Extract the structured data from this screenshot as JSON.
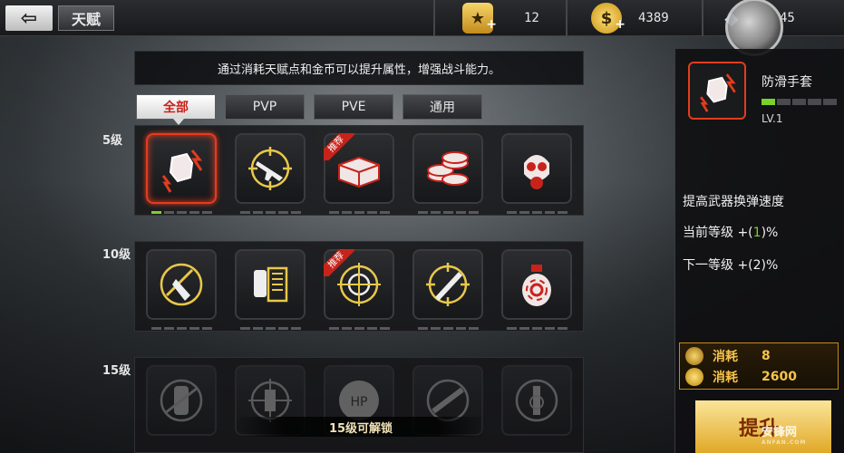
{
  "header": {
    "title": "天赋",
    "back_icon": "back-arrow-icon"
  },
  "resources": [
    {
      "icon": "rank-badge-icon",
      "value": "12"
    },
    {
      "icon": "gold-coin-icon",
      "value": "4389"
    },
    {
      "icon": "diamond-icon",
      "value": "45"
    }
  ],
  "notice": "通过消耗天赋点和金币可以提升属性，增强战斗能力。",
  "tabs": [
    {
      "label": "全部",
      "active": true
    },
    {
      "label": "PVP",
      "active": false
    },
    {
      "label": "PVE",
      "active": false
    },
    {
      "label": "通用",
      "active": false
    }
  ],
  "tiers": [
    {
      "label": "5级",
      "talents": [
        {
          "icon": "glove-icon",
          "selected": true,
          "badge": "",
          "progress": 1
        },
        {
          "icon": "rifle-crosshair-icon",
          "badge": "",
          "progress": 0
        },
        {
          "icon": "ammo-box-icon",
          "badge": "推荐",
          "progress": 0
        },
        {
          "icon": "coin-stack-icon",
          "badge": "",
          "progress": 0
        },
        {
          "icon": "gas-mask-icon",
          "badge": "",
          "progress": 0
        }
      ]
    },
    {
      "label": "10级",
      "talents": [
        {
          "icon": "knife-slash-icon",
          "badge": "",
          "progress": 0
        },
        {
          "icon": "magazine-icon",
          "badge": "",
          "progress": 0
        },
        {
          "icon": "target-scope-icon",
          "badge": "推荐",
          "progress": 0
        },
        {
          "icon": "blade-crosshair-icon",
          "badge": "",
          "progress": 0
        },
        {
          "icon": "biohazard-grenade-icon",
          "badge": "",
          "progress": 0
        }
      ]
    },
    {
      "label": "15级",
      "locked": true,
      "unlock_text": "15级可解锁",
      "talents": [
        {
          "icon": "grenade-cancel-icon"
        },
        {
          "icon": "ammo-crosshair-icon"
        },
        {
          "icon": "hp-shield-icon"
        },
        {
          "icon": "gun-cancel-icon"
        },
        {
          "icon": "biohazard-badge-icon"
        }
      ]
    }
  ],
  "detail": {
    "name": "防滑手套",
    "level": "LV.1",
    "level_progress": 0.2,
    "description": "提高武器换弹速度",
    "current_prefix": "当前等级 +(",
    "current_value": "1",
    "current_suffix": ")%",
    "next_line": "下一等级 +(2)%",
    "cost_label": "消耗",
    "cost_points": "8",
    "cost_gold": "2600",
    "upgrade_label": "提升"
  },
  "watermark": {
    "main": "安锋网",
    "sub": "ANFAN.COM"
  },
  "colors": {
    "accent_red": "#e33c1e",
    "progress_green": "#7bd12a",
    "gold": "#f6c44a"
  }
}
